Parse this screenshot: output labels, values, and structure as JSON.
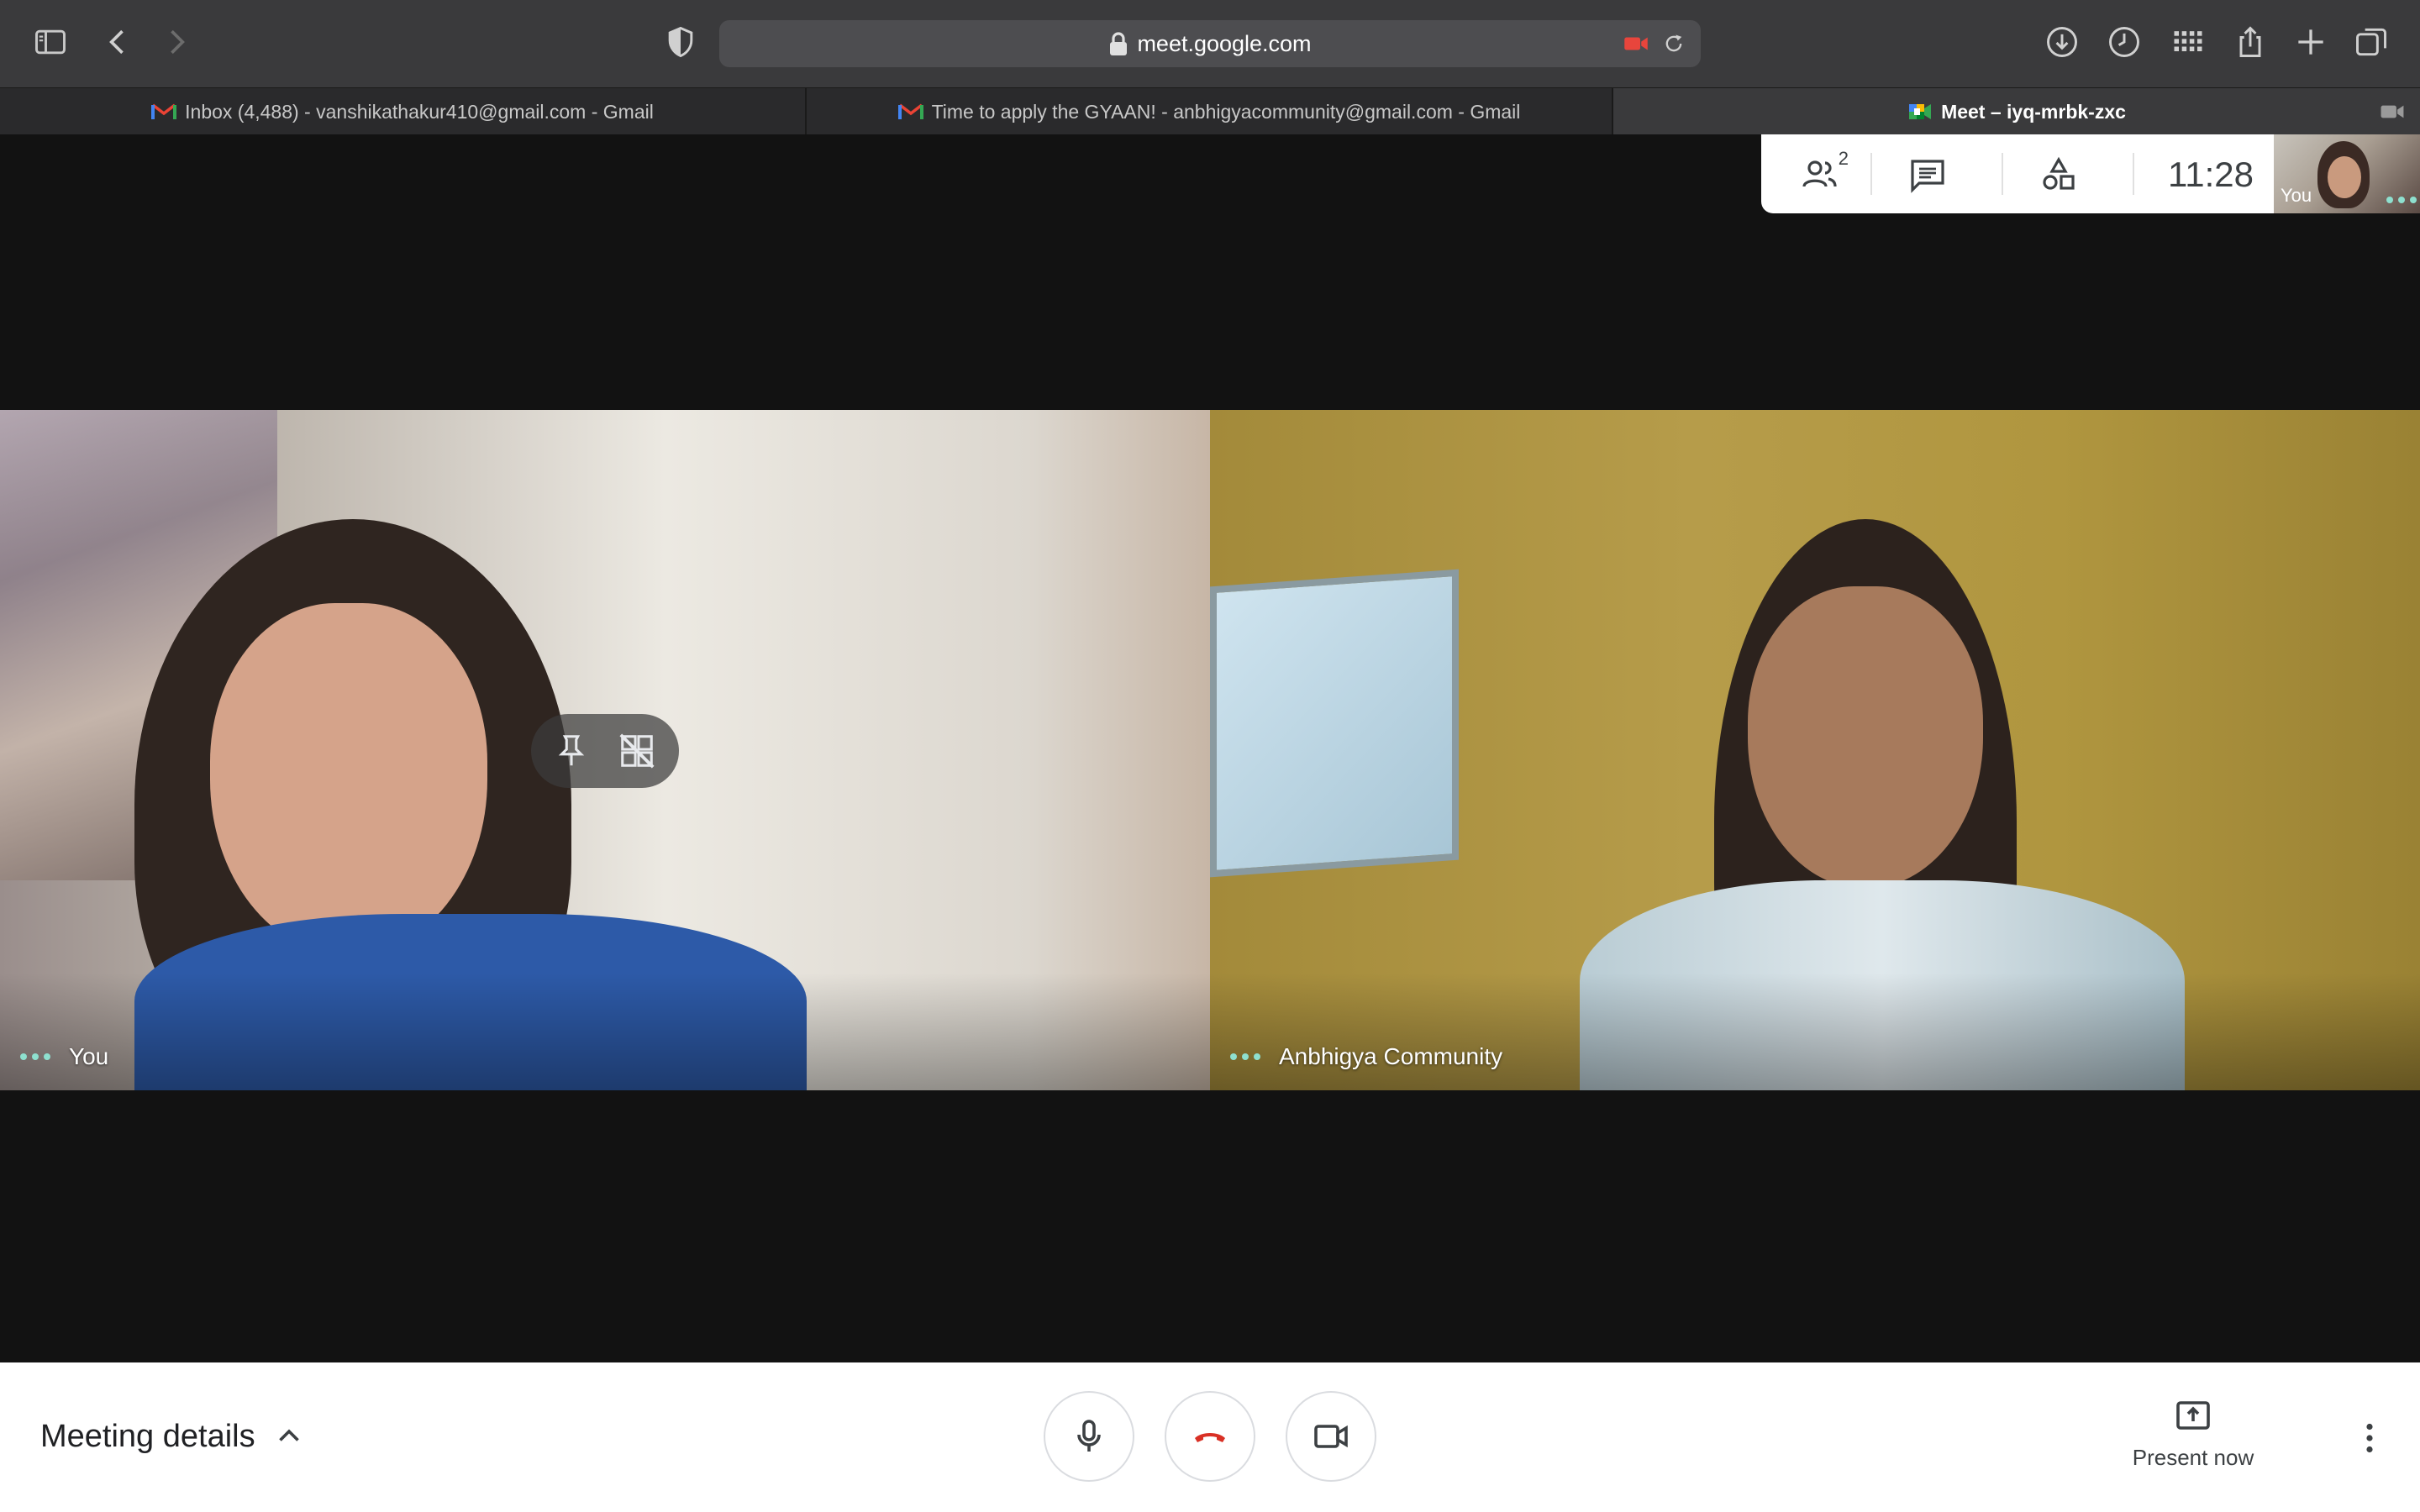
{
  "browser": {
    "url": "meet.google.com",
    "tabs": [
      {
        "label": "Inbox (4,488) - vanshikathakur410@gmail.com - Gmail",
        "icon": "gmail-icon",
        "active": false
      },
      {
        "label": "Time to apply the GYAAN! - anbhigyacommunity@gmail.com - Gmail",
        "icon": "gmail-icon",
        "active": false
      },
      {
        "label": "Meet – iyq-mrbk-zxc",
        "icon": "meet-icon",
        "active": true
      }
    ]
  },
  "meet": {
    "participants_count": "2",
    "clock": "11:28",
    "self_thumb_label": "You",
    "tiles": [
      {
        "name": "You"
      },
      {
        "name": "Anbhigya Community"
      }
    ],
    "bottom": {
      "meeting_details": "Meeting details",
      "present_now": "Present now"
    }
  },
  "colors": {
    "chrome_bg": "#3a3a3c",
    "stage_bg": "#121212",
    "end_call_red": "#d93025",
    "speaking_dots": "#8ee0cf"
  }
}
